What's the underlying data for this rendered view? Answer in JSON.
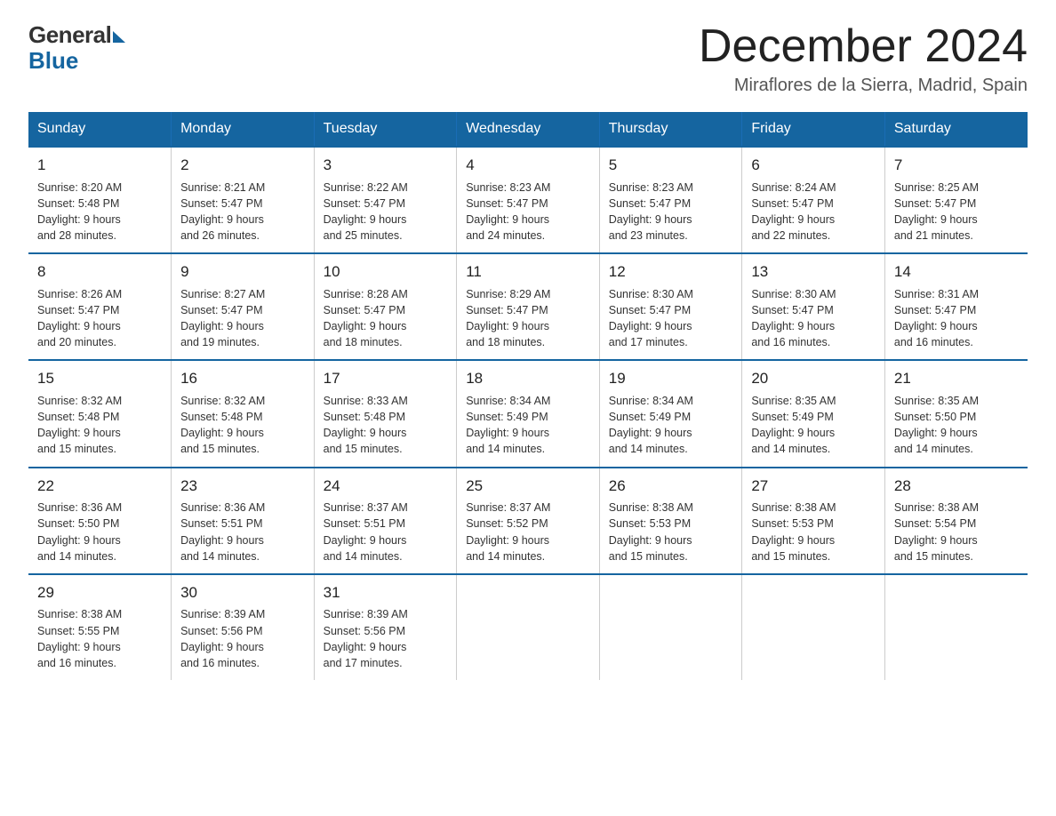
{
  "logo": {
    "general": "General",
    "blue": "Blue"
  },
  "title": "December 2024",
  "location": "Miraflores de la Sierra, Madrid, Spain",
  "days_of_week": [
    "Sunday",
    "Monday",
    "Tuesday",
    "Wednesday",
    "Thursday",
    "Friday",
    "Saturday"
  ],
  "weeks": [
    [
      {
        "day": "1",
        "sunrise": "8:20 AM",
        "sunset": "5:48 PM",
        "daylight": "9 hours and 28 minutes."
      },
      {
        "day": "2",
        "sunrise": "8:21 AM",
        "sunset": "5:47 PM",
        "daylight": "9 hours and 26 minutes."
      },
      {
        "day": "3",
        "sunrise": "8:22 AM",
        "sunset": "5:47 PM",
        "daylight": "9 hours and 25 minutes."
      },
      {
        "day": "4",
        "sunrise": "8:23 AM",
        "sunset": "5:47 PM",
        "daylight": "9 hours and 24 minutes."
      },
      {
        "day": "5",
        "sunrise": "8:23 AM",
        "sunset": "5:47 PM",
        "daylight": "9 hours and 23 minutes."
      },
      {
        "day": "6",
        "sunrise": "8:24 AM",
        "sunset": "5:47 PM",
        "daylight": "9 hours and 22 minutes."
      },
      {
        "day": "7",
        "sunrise": "8:25 AM",
        "sunset": "5:47 PM",
        "daylight": "9 hours and 21 minutes."
      }
    ],
    [
      {
        "day": "8",
        "sunrise": "8:26 AM",
        "sunset": "5:47 PM",
        "daylight": "9 hours and 20 minutes."
      },
      {
        "day": "9",
        "sunrise": "8:27 AM",
        "sunset": "5:47 PM",
        "daylight": "9 hours and 19 minutes."
      },
      {
        "day": "10",
        "sunrise": "8:28 AM",
        "sunset": "5:47 PM",
        "daylight": "9 hours and 18 minutes."
      },
      {
        "day": "11",
        "sunrise": "8:29 AM",
        "sunset": "5:47 PM",
        "daylight": "9 hours and 18 minutes."
      },
      {
        "day": "12",
        "sunrise": "8:30 AM",
        "sunset": "5:47 PM",
        "daylight": "9 hours and 17 minutes."
      },
      {
        "day": "13",
        "sunrise": "8:30 AM",
        "sunset": "5:47 PM",
        "daylight": "9 hours and 16 minutes."
      },
      {
        "day": "14",
        "sunrise": "8:31 AM",
        "sunset": "5:47 PM",
        "daylight": "9 hours and 16 minutes."
      }
    ],
    [
      {
        "day": "15",
        "sunrise": "8:32 AM",
        "sunset": "5:48 PM",
        "daylight": "9 hours and 15 minutes."
      },
      {
        "day": "16",
        "sunrise": "8:32 AM",
        "sunset": "5:48 PM",
        "daylight": "9 hours and 15 minutes."
      },
      {
        "day": "17",
        "sunrise": "8:33 AM",
        "sunset": "5:48 PM",
        "daylight": "9 hours and 15 minutes."
      },
      {
        "day": "18",
        "sunrise": "8:34 AM",
        "sunset": "5:49 PM",
        "daylight": "9 hours and 14 minutes."
      },
      {
        "day": "19",
        "sunrise": "8:34 AM",
        "sunset": "5:49 PM",
        "daylight": "9 hours and 14 minutes."
      },
      {
        "day": "20",
        "sunrise": "8:35 AM",
        "sunset": "5:49 PM",
        "daylight": "9 hours and 14 minutes."
      },
      {
        "day": "21",
        "sunrise": "8:35 AM",
        "sunset": "5:50 PM",
        "daylight": "9 hours and 14 minutes."
      }
    ],
    [
      {
        "day": "22",
        "sunrise": "8:36 AM",
        "sunset": "5:50 PM",
        "daylight": "9 hours and 14 minutes."
      },
      {
        "day": "23",
        "sunrise": "8:36 AM",
        "sunset": "5:51 PM",
        "daylight": "9 hours and 14 minutes."
      },
      {
        "day": "24",
        "sunrise": "8:37 AM",
        "sunset": "5:51 PM",
        "daylight": "9 hours and 14 minutes."
      },
      {
        "day": "25",
        "sunrise": "8:37 AM",
        "sunset": "5:52 PM",
        "daylight": "9 hours and 14 minutes."
      },
      {
        "day": "26",
        "sunrise": "8:38 AM",
        "sunset": "5:53 PM",
        "daylight": "9 hours and 15 minutes."
      },
      {
        "day": "27",
        "sunrise": "8:38 AM",
        "sunset": "5:53 PM",
        "daylight": "9 hours and 15 minutes."
      },
      {
        "day": "28",
        "sunrise": "8:38 AM",
        "sunset": "5:54 PM",
        "daylight": "9 hours and 15 minutes."
      }
    ],
    [
      {
        "day": "29",
        "sunrise": "8:38 AM",
        "sunset": "5:55 PM",
        "daylight": "9 hours and 16 minutes."
      },
      {
        "day": "30",
        "sunrise": "8:39 AM",
        "sunset": "5:56 PM",
        "daylight": "9 hours and 16 minutes."
      },
      {
        "day": "31",
        "sunrise": "8:39 AM",
        "sunset": "5:56 PM",
        "daylight": "9 hours and 17 minutes."
      },
      null,
      null,
      null,
      null
    ]
  ],
  "labels": {
    "sunrise": "Sunrise:",
    "sunset": "Sunset:",
    "daylight": "Daylight:"
  }
}
